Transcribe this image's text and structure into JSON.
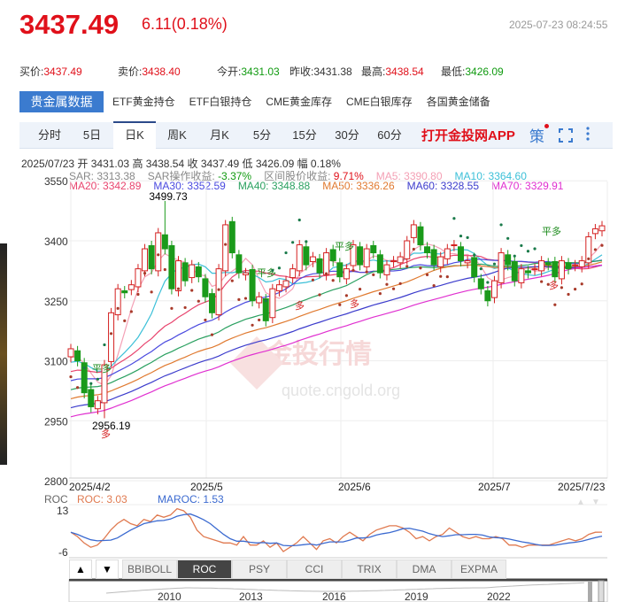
{
  "header": {
    "price": "3437.49",
    "change": "6.11(0.18%)",
    "datetime": "2025-07-23 08:24:55"
  },
  "quotes": [
    {
      "label": "买价:",
      "value": "3437.49",
      "color": "red"
    },
    {
      "label": "卖价:",
      "value": "3438.40",
      "color": "red"
    },
    {
      "label": "今开:",
      "value": "3431.03",
      "color": "green"
    },
    {
      "label": "昨收:",
      "value": "3431.38",
      "color": ""
    },
    {
      "label": "最高:",
      "value": "3438.54",
      "color": "red"
    },
    {
      "label": "最低:",
      "value": "3426.09",
      "color": "green"
    }
  ],
  "tabs": [
    "贵金属数据",
    "ETF黄金持仓",
    "ETF白银持仓",
    "CME黄金库存",
    "CME白银库存",
    "各国黄金储备"
  ],
  "periods": [
    "分时",
    "5日",
    "日K",
    "周K",
    "月K",
    "5分",
    "15分",
    "30分",
    "60分"
  ],
  "active_period": "日K",
  "app_link": "打开金投网APP",
  "strategy_label": "策",
  "ohlc_line": "2025/07/23  开 3431.03  高 3438.54  收 3437.49  低 3426.09  幅 0.18%",
  "indicators1": [
    {
      "text": "SAR: 3313.38",
      "color": "#888"
    },
    {
      "text": "SAR操作收益: ",
      "color": "#888",
      "value": "-3.37%",
      "vcolor": "#109a10"
    },
    {
      "text": "区间股价收益: ",
      "color": "#888",
      "value": "9.71%",
      "vcolor": "#e0101a"
    },
    {
      "text": "MA5: 3390.80",
      "color": "#f4a0b5"
    },
    {
      "text": "MA10: 3364.60",
      "color": "#3cc0d8"
    }
  ],
  "indicators2": [
    {
      "text": "MA20: 3342.89",
      "color": "#e8446e"
    },
    {
      "text": "MA30: 3352.59",
      "color": "#4a4adf"
    },
    {
      "text": "MA40: 3348.88",
      "color": "#2aa060"
    },
    {
      "text": "MA50: 3336.26",
      "color": "#e07a30"
    },
    {
      "text": "MA60: 3328.55",
      "color": "#3c3ccc"
    },
    {
      "text": "MA70: 3329.91",
      "color": "#e030d0"
    }
  ],
  "chart_data": {
    "type": "candlestick",
    "ylim": [
      2800,
      3550
    ],
    "yticks": [
      "3550",
      "3400",
      "3250",
      "3100",
      "2950",
      "2800"
    ],
    "xticks": [
      "2025/4/2",
      "2025/5",
      "2025/6",
      "2025/7",
      "2025/7/23"
    ],
    "max_label": "3499.73",
    "min_label": "2956.19",
    "signals": [
      "平多",
      "平多",
      "平多",
      "平多",
      "多",
      "多",
      "多",
      "多"
    ],
    "closes": [
      3130,
      3100,
      3020,
      2985,
      3000,
      3090,
      3220,
      3280,
      3270,
      3290,
      3330,
      3380,
      3330,
      3420,
      3380,
      3280,
      3350,
      3300,
      3340,
      3310,
      3260,
      3220,
      3330,
      3440,
      3370,
      3320,
      3320,
      3250,
      3260,
      3200,
      3280,
      3290,
      3300,
      3330,
      3390,
      3340,
      3360,
      3320,
      3370,
      3350,
      3310,
      3330,
      3390,
      3340,
      3380,
      3370,
      3320,
      3340,
      3350,
      3360,
      3400,
      3440,
      3390,
      3370,
      3340,
      3360,
      3380,
      3390,
      3350,
      3350,
      3310,
      3280,
      3250,
      3300,
      3370,
      3340,
      3300,
      3330,
      3320,
      3330,
      3350,
      3340,
      3310,
      3350,
      3330,
      3340,
      3350,
      3410,
      3430,
      3437.49
    ],
    "roc": {
      "label": "ROC",
      "roc_text": "ROC: 3.03",
      "maroc_text": "MAROC: 1.53",
      "ticks": [
        "13",
        "-6"
      ],
      "ylim": [
        -7,
        14
      ],
      "values": [
        3,
        1,
        -2,
        -4,
        -3,
        0,
        4,
        7,
        9,
        7,
        6,
        9,
        8,
        11,
        10,
        11,
        14,
        13,
        10,
        4,
        1,
        0,
        -1,
        -2,
        -2,
        -3,
        1,
        -3,
        -3,
        -1,
        -4,
        -2,
        -6,
        -4,
        -2,
        1,
        -2,
        -5,
        -1,
        0,
        -2,
        1,
        3,
        1,
        -1,
        2,
        4,
        5,
        6,
        6,
        5,
        3,
        0,
        1,
        -1,
        1,
        2,
        5,
        3,
        1,
        0,
        1,
        0,
        0,
        1,
        0,
        -3,
        -3,
        -4,
        -3,
        -3,
        -3,
        -3,
        -2,
        -1,
        0,
        -1,
        0,
        2,
        3,
        3.03
      ]
    },
    "navigator_years": [
      "2010",
      "2013",
      "2016",
      "2019",
      "2022"
    ]
  },
  "indicator_tabs": [
    "BBIBOLL",
    "ROC",
    "PSY",
    "CCI",
    "TRIX",
    "DMA",
    "EXPMA"
  ],
  "active_indicator": "ROC",
  "watermark": {
    "cn": "金投行情",
    "url": "quote.cngold.org"
  }
}
